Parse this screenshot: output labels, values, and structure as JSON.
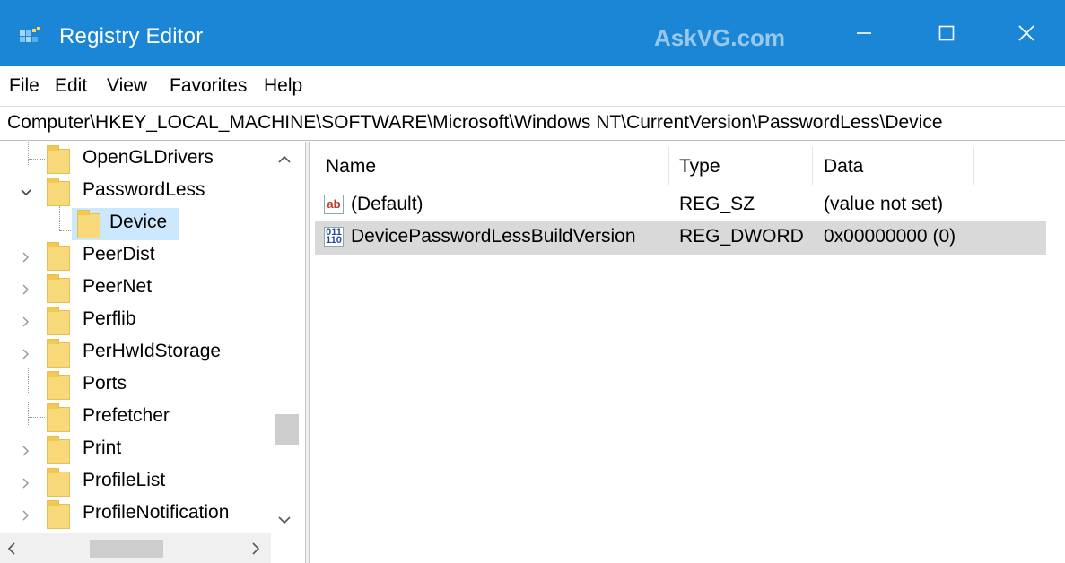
{
  "window": {
    "title": "Registry Editor",
    "watermark": "AskVG.com",
    "icons": [
      "registry-app-icon",
      "minimize-icon",
      "maximize-icon",
      "close-icon"
    ]
  },
  "menu": {
    "items": [
      "File",
      "Edit",
      "View",
      "Favorites",
      "Help"
    ]
  },
  "address": {
    "path": "Computer\\HKEY_LOCAL_MACHINE\\SOFTWARE\\Microsoft\\Windows NT\\CurrentVersion\\PasswordLess\\Device"
  },
  "tree": {
    "items": [
      {
        "label": "OpenGLDrivers",
        "expander": "none"
      },
      {
        "label": "PasswordLess",
        "expander": "expanded"
      },
      {
        "label": "Device",
        "expander": "none",
        "selected": true
      },
      {
        "label": "PeerDist",
        "expander": "collapsed"
      },
      {
        "label": "PeerNet",
        "expander": "collapsed"
      },
      {
        "label": "Perflib",
        "expander": "collapsed"
      },
      {
        "label": "PerHwIdStorage",
        "expander": "collapsed"
      },
      {
        "label": "Ports",
        "expander": "none"
      },
      {
        "label": "Prefetcher",
        "expander": "none"
      },
      {
        "label": "Print",
        "expander": "collapsed"
      },
      {
        "label": "ProfileList",
        "expander": "collapsed"
      },
      {
        "label": "ProfileNotification",
        "expander": "collapsed"
      }
    ]
  },
  "list": {
    "columns": {
      "name": "Name",
      "type": "Type",
      "data": "Data"
    },
    "rows": [
      {
        "icon": "string-value-icon",
        "icon_text": "ab",
        "name": "(Default)",
        "type": "REG_SZ",
        "data": "(value not set)"
      },
      {
        "icon": "binary-value-icon",
        "icon_text": "011 110",
        "name": "DevicePasswordLessBuildVersion",
        "type": "REG_DWORD",
        "data": "0x00000000 (0)"
      }
    ]
  },
  "colors": {
    "titlebar": "#1b85d6",
    "selection": "#cce8ff",
    "row_highlight": "#d9d9d9",
    "folder": "#f8d979"
  }
}
